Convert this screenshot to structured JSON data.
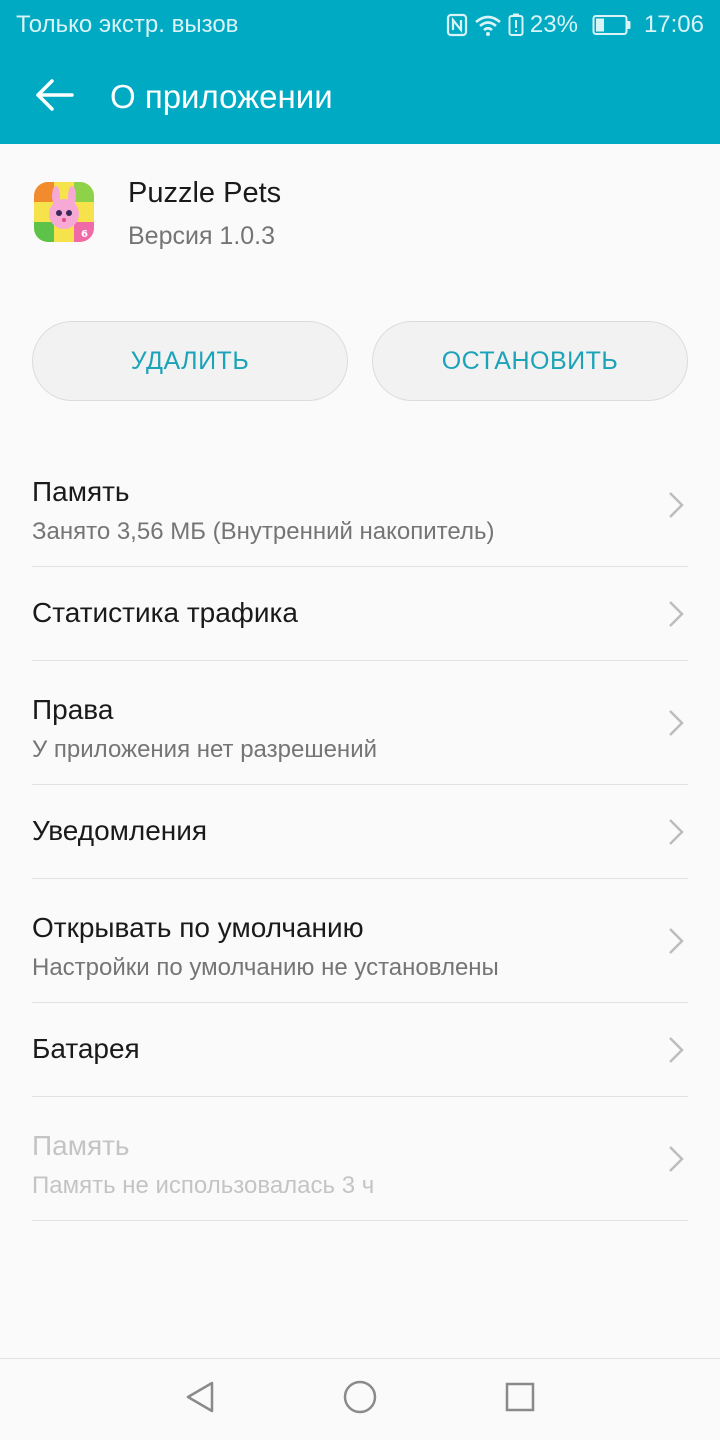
{
  "status_bar": {
    "carrier_text": "Только экстр. вызов",
    "battery_percent": "23%",
    "time": "17:06",
    "icons": [
      "nfc-icon",
      "wifi-icon",
      "battery-alert-icon",
      "battery-icon"
    ]
  },
  "app_bar": {
    "title": "О приложении",
    "back_icon": "arrow-left-icon"
  },
  "app": {
    "name": "Puzzle Pets",
    "version": "Версия 1.0.3"
  },
  "actions": {
    "uninstall_label": "УДАЛИТЬ",
    "force_stop_label": "ОСТАНОВИТЬ"
  },
  "settings": [
    {
      "title": "Память",
      "subtitle": "Занято 3,56 МБ (Внутренний накопитель)",
      "enabled": true
    },
    {
      "title": "Статистика трафика",
      "subtitle": "",
      "enabled": true
    },
    {
      "title": "Права",
      "subtitle": "У приложения нет разрешений",
      "enabled": true
    },
    {
      "title": "Уведомления",
      "subtitle": "",
      "enabled": true
    },
    {
      "title": "Открывать по умолчанию",
      "subtitle": "Настройки по умолчанию не установлены",
      "enabled": true
    },
    {
      "title": "Батарея",
      "subtitle": "",
      "enabled": true
    },
    {
      "title": "Память",
      "subtitle": "Память не использовалась 3 ч",
      "enabled": false
    }
  ],
  "nav_bar": {
    "icons": [
      "nav-back-icon",
      "nav-home-icon",
      "nav-recents-icon"
    ]
  },
  "colors": {
    "accent": "#00aac2",
    "button_text": "#1ba3b8",
    "background": "#fafafa"
  }
}
